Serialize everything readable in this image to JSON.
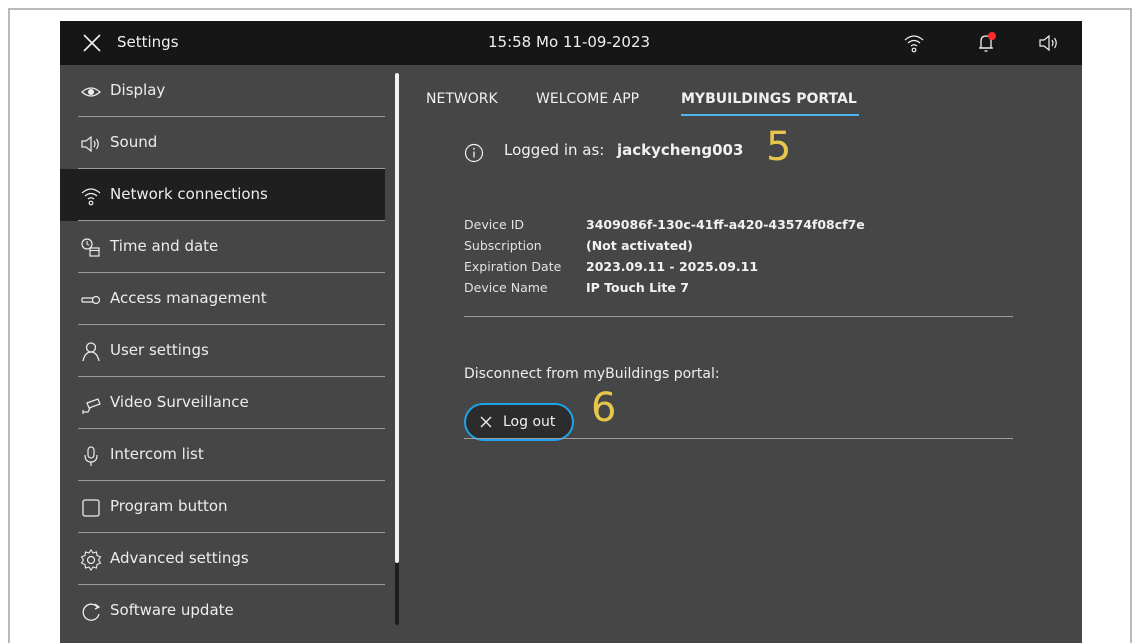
{
  "topbar": {
    "title": "Settings",
    "datetime": "15:58  Mo 11-09-2023",
    "icons": [
      "close-icon",
      "wifi-icon",
      "bell-icon",
      "speaker-icon"
    ],
    "notification_color": "#ff2a2a"
  },
  "sidebar": {
    "items": [
      {
        "label": "Display",
        "icon": "eye-icon"
      },
      {
        "label": "Sound",
        "icon": "speaker-icon"
      },
      {
        "label": "Network connections",
        "icon": "wifi-icon",
        "active": true
      },
      {
        "label": "Time and date",
        "icon": "clock-calendar-icon"
      },
      {
        "label": "Access  management",
        "icon": "key-icon"
      },
      {
        "label": "User settings",
        "icon": "user-icon"
      },
      {
        "label": "Video Surveillance",
        "icon": "camera-icon"
      },
      {
        "label": "Intercom list",
        "icon": "microphone-icon"
      },
      {
        "label": "Program button",
        "icon": "square-icon"
      },
      {
        "label": "Advanced settings",
        "icon": "gear-icon"
      },
      {
        "label": "Software update",
        "icon": "refresh-icon"
      }
    ]
  },
  "tabs": [
    {
      "label": "NETWORK"
    },
    {
      "label": "WELCOME APP"
    },
    {
      "label": "MYBUILDINGS PORTAL",
      "active": true
    }
  ],
  "login": {
    "label": "Logged in as:",
    "username": "jackycheng003",
    "marker": "5"
  },
  "details": [
    {
      "key": "Device ID",
      "value": "3409086f-130c-41ff-a420-43574f08cf7e"
    },
    {
      "key": "Subscription",
      "value": "(Not activated)"
    },
    {
      "key": "Expiration Date",
      "value": "2023.09.11 - 2025.09.11"
    },
    {
      "key": "Device Name",
      "value": "IP Touch Lite 7"
    }
  ],
  "disconnect": {
    "label": "Disconnect from myBuildings portal:",
    "button_label": "Log out",
    "marker": "6"
  },
  "colors": {
    "accent": "#1ea3e8",
    "tab_underline": "#4fb4f0",
    "marker": "#e6c64c",
    "background": "#464646",
    "topbar": "#161616"
  }
}
